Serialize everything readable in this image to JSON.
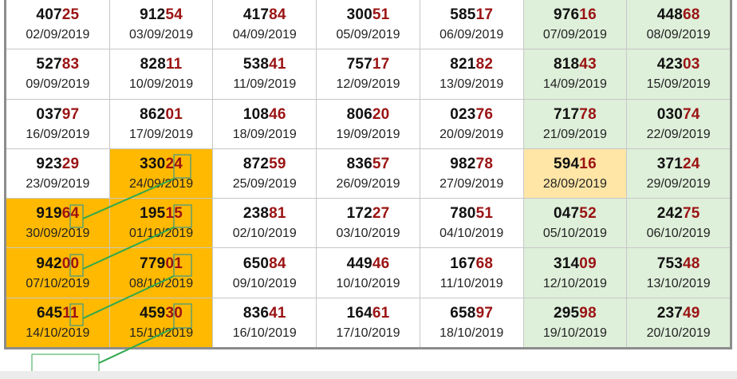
{
  "colors": {
    "highlight": "#ffb900",
    "weekend": "#deefda",
    "soft_highlight": "#ffe6a6",
    "last_digits": "#9b1313",
    "connector": "#2fa84f"
  },
  "rows": [
    [
      {
        "first": "407",
        "last": "25",
        "date": "02/09/2019"
      },
      {
        "first": "912",
        "last": "54",
        "date": "03/09/2019"
      },
      {
        "first": "417",
        "last": "84",
        "date": "04/09/2019"
      },
      {
        "first": "300",
        "last": "51",
        "date": "05/09/2019"
      },
      {
        "first": "585",
        "last": "17",
        "date": "06/09/2019"
      },
      {
        "first": "976",
        "last": "16",
        "date": "07/09/2019"
      },
      {
        "first": "448",
        "last": "68",
        "date": "08/09/2019"
      }
    ],
    [
      {
        "first": "527",
        "last": "83",
        "date": "09/09/2019"
      },
      {
        "first": "828",
        "last": "11",
        "date": "10/09/2019"
      },
      {
        "first": "538",
        "last": "41",
        "date": "11/09/2019"
      },
      {
        "first": "757",
        "last": "17",
        "date": "12/09/2019"
      },
      {
        "first": "821",
        "last": "82",
        "date": "13/09/2019"
      },
      {
        "first": "818",
        "last": "43",
        "date": "14/09/2019"
      },
      {
        "first": "423",
        "last": "03",
        "date": "15/09/2019"
      }
    ],
    [
      {
        "first": "037",
        "last": "97",
        "date": "16/09/2019"
      },
      {
        "first": "862",
        "last": "01",
        "date": "17/09/2019"
      },
      {
        "first": "108",
        "last": "46",
        "date": "18/09/2019"
      },
      {
        "first": "806",
        "last": "20",
        "date": "19/09/2019"
      },
      {
        "first": "023",
        "last": "76",
        "date": "20/09/2019"
      },
      {
        "first": "717",
        "last": "78",
        "date": "21/09/2019"
      },
      {
        "first": "030",
        "last": "74",
        "date": "22/09/2019"
      }
    ],
    [
      {
        "first": "923",
        "last": "29",
        "date": "23/09/2019"
      },
      {
        "first": "330",
        "last": "24",
        "date": "24/09/2019",
        "hl": "hl"
      },
      {
        "first": "872",
        "last": "59",
        "date": "25/09/2019"
      },
      {
        "first": "836",
        "last": "57",
        "date": "26/09/2019"
      },
      {
        "first": "982",
        "last": "78",
        "date": "27/09/2019"
      },
      {
        "first": "594",
        "last": "16",
        "date": "28/09/2019",
        "hl": "soft"
      },
      {
        "first": "371",
        "last": "24",
        "date": "29/09/2019"
      }
    ],
    [
      {
        "first": "919",
        "last": "64",
        "date": "30/09/2019",
        "hl": "hl"
      },
      {
        "first": "195",
        "last": "15",
        "date": "01/10/2019",
        "hl": "hl"
      },
      {
        "first": "238",
        "last": "81",
        "date": "02/10/2019"
      },
      {
        "first": "172",
        "last": "27",
        "date": "03/10/2019"
      },
      {
        "first": "780",
        "last": "51",
        "date": "04/10/2019"
      },
      {
        "first": "047",
        "last": "52",
        "date": "05/10/2019"
      },
      {
        "first": "242",
        "last": "75",
        "date": "06/10/2019"
      }
    ],
    [
      {
        "first": "942",
        "last": "00",
        "date": "07/10/2019",
        "hl": "hl"
      },
      {
        "first": "779",
        "last": "01",
        "date": "08/10/2019",
        "hl": "hl"
      },
      {
        "first": "650",
        "last": "84",
        "date": "09/10/2019"
      },
      {
        "first": "449",
        "last": "46",
        "date": "10/10/2019"
      },
      {
        "first": "167",
        "last": "68",
        "date": "11/10/2019"
      },
      {
        "first": "314",
        "last": "09",
        "date": "12/10/2019"
      },
      {
        "first": "753",
        "last": "48",
        "date": "13/10/2019"
      }
    ],
    [
      {
        "first": "645",
        "last": "11",
        "date": "14/10/2019",
        "hl": "hl"
      },
      {
        "first": "459",
        "last": "30",
        "date": "15/10/2019",
        "hl": "hl"
      },
      {
        "first": "836",
        "last": "41",
        "date": "16/10/2019"
      },
      {
        "first": "164",
        "last": "61",
        "date": "17/10/2019"
      },
      {
        "first": "658",
        "last": "97",
        "date": "18/10/2019"
      },
      {
        "first": "295",
        "last": "98",
        "date": "19/10/2019"
      },
      {
        "first": "237",
        "last": "49",
        "date": "20/10/2019"
      }
    ]
  ]
}
